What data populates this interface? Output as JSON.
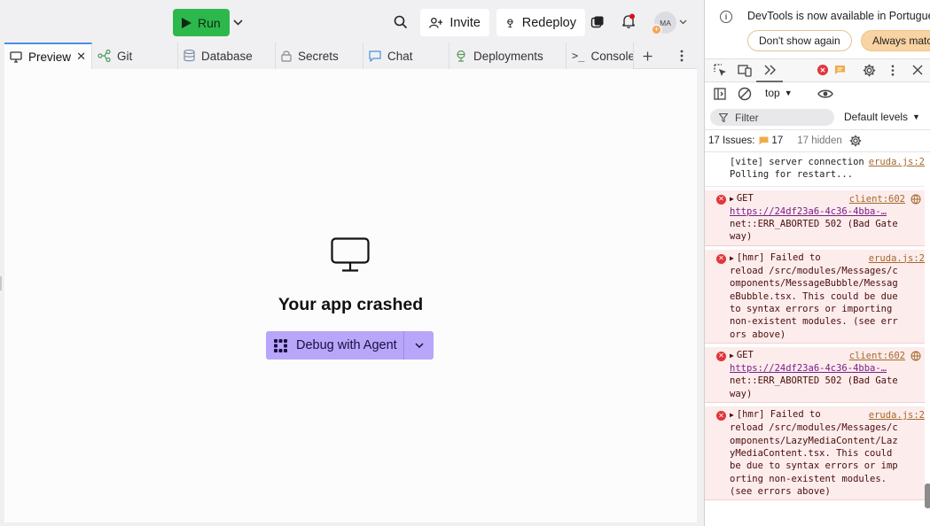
{
  "toolbar": {
    "run_label": "Run",
    "invite_label": "Invite",
    "redeploy_label": "Redeploy",
    "avatar_initials": "MA"
  },
  "tabs": [
    {
      "label": "Preview",
      "icon": "monitor-icon",
      "active": true
    },
    {
      "label": "Git",
      "icon": "git-icon"
    },
    {
      "label": "Database",
      "icon": "database-icon"
    },
    {
      "label": "Secrets",
      "icon": "lock-icon"
    },
    {
      "label": "Chat",
      "icon": "chat-icon"
    },
    {
      "label": "Deployments",
      "icon": "deploy-icon"
    },
    {
      "label": "Console",
      "icon": "terminal-icon"
    }
  ],
  "preview": {
    "title": "Your app crashed",
    "debug_label": "Debug with Agent"
  },
  "devtools": {
    "info_text": "DevTools is now available in Portuguese",
    "dont_show_label": "Don't show again",
    "always_match_label": "Always match Chrome's language",
    "context": "top",
    "filter_placeholder": "Filter",
    "levels_label": "Default levels",
    "issues_label": "17 Issues:",
    "issues_count": "17",
    "hidden_label": "17 hidden",
    "accent_error": "#e2353b",
    "accent_warning": "#f0ab49"
  },
  "console": [
    {
      "type": "info",
      "text": "[vite] server connection lost. Polling for restart...",
      "source": "eruda.js:2"
    },
    {
      "type": "error",
      "prefix": "GET",
      "url": "https://24df23a6-4c36-4bba-…",
      "text": "net::ERR_ABORTED 502 (Bad Gateway)",
      "source": "client:602"
    },
    {
      "type": "error",
      "prefix": "[hmr] Failed to",
      "text": "reload /src/modules/Messages/components/MessageBubble/MessageBubble.tsx. This could be due to syntax errors or importing non-existent modules. (see errors above)",
      "source": "eruda.js:2"
    },
    {
      "type": "error",
      "prefix": "GET",
      "url": "https://24df23a6-4c36-4bba-…",
      "text": "net::ERR_ABORTED 502 (Bad Gateway)",
      "source": "client:602"
    },
    {
      "type": "error",
      "prefix": "[hmr] Failed to",
      "text": "reload /src/modules/Messages/components/LazyMediaContent/LazyMediaContent.tsx. This could be due to syntax errors or importing non-existent modules. (see errors above)",
      "source": "eruda.js:2"
    }
  ]
}
